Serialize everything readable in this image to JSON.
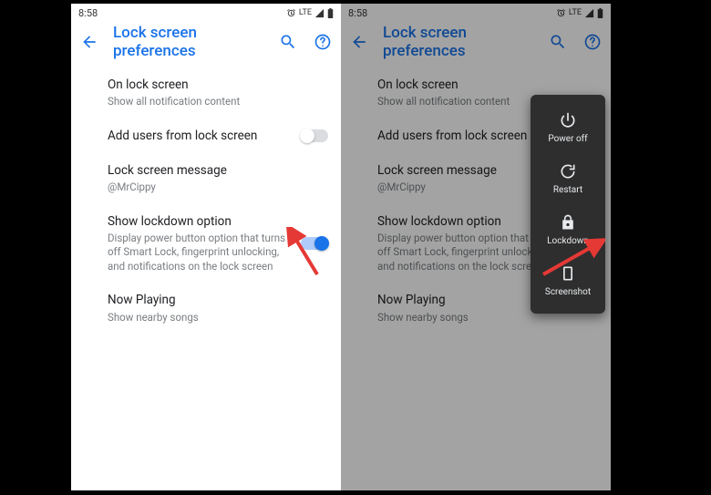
{
  "status": {
    "time": "8:58",
    "network": "LTE"
  },
  "appbar": {
    "title": "Lock screen preferences"
  },
  "items": {
    "onLock": {
      "title": "On lock screen",
      "sub": "Show all notification content"
    },
    "addUsers": {
      "title": "Add users from lock screen"
    },
    "message": {
      "title": "Lock screen message",
      "sub": "@MrCippy"
    },
    "lockdown": {
      "title": "Show lockdown option",
      "sub": "Display power button option that turns off Smart Lock, fingerprint unlocking, and notifications on the lock screen"
    },
    "nowPlaying": {
      "title": "Now Playing",
      "sub": "Show nearby songs"
    }
  },
  "powermenu": {
    "poweroff": "Power off",
    "restart": "Restart",
    "lockdown": "Lockdown",
    "screenshot": "Screenshot"
  },
  "colors": {
    "accent": "#1a73e8"
  }
}
